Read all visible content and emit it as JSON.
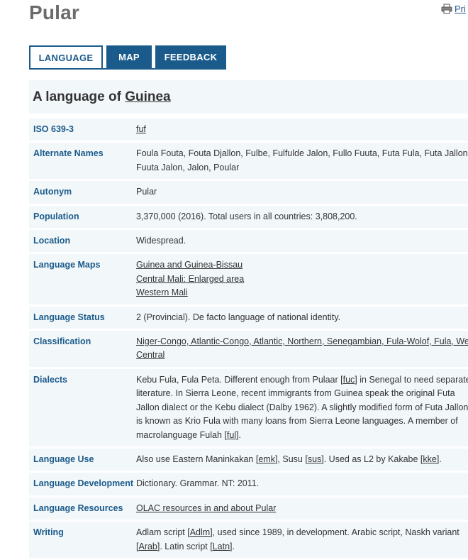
{
  "page": {
    "title": "Pular",
    "print_label": "Pri"
  },
  "tabs": [
    {
      "label": "LANGUAGE"
    },
    {
      "label": "MAP"
    },
    {
      "label": "FEEDBACK"
    }
  ],
  "heading": {
    "prefix": "A language of ",
    "country": "Guinea"
  },
  "rows": {
    "iso": {
      "label": "ISO 639-3",
      "value": "fuf"
    },
    "alternate_names": {
      "label": "Alternate Names",
      "lines": [
        "Foula Fouta, Fouta Djallon, Fulbe, Fulfulde Jalon, Fullo Fuuta, Futa Fula, Futa Jallon,",
        "Fuuta Jalon, Jalon, Poular"
      ]
    },
    "autonym": {
      "label": "Autonym",
      "value": "Pular"
    },
    "population": {
      "label": "Population",
      "value": "3,370,000 (2016). Total users in all countries: 3,808,200."
    },
    "location": {
      "label": "Location",
      "value": "Widespread."
    },
    "language_maps": {
      "label": "Language Maps",
      "links": [
        "Guinea and Guinea-Bissau",
        "Central Mali: Enlarged area",
        "Western Mali"
      ]
    },
    "language_status": {
      "label": "Language Status",
      "value": "2 (Provincial). De facto language of national identity."
    },
    "classification": {
      "label": "Classification",
      "lines": [
        "Niger-Congo, Atlantic-Congo, Atlantic, Northern, Senegambian, Fula-Wolof, Fula, West",
        "Central"
      ]
    },
    "dialects": {
      "label": "Dialects",
      "line1_a": "Kebu Fula, Fula Peta. Different enough from Pulaar [",
      "line1_code": "fuc",
      "line1_b": "] in Senegal to need separate",
      "line2": "literature. In Sierra Leone, recent immigrants from Guinea speak the original Futa",
      "line3": "Jallon dialect or the Kebu dialect (Dalby 1962). A slightly modified form of Futa Jallon",
      "line4": "is known as Krio Fula with many loans from Sierra Leone languages. A member of",
      "line5_a": "macrolanguage Fulah [",
      "line5_code": "ful",
      "line5_b": "]."
    },
    "language_use": {
      "label": "Language Use",
      "t1": "Also use Eastern Maninkakan [",
      "c1": "emk",
      "t2": "], Susu [",
      "c2": "sus",
      "t3": "]. Used as L2 by Kakabe [",
      "c3": "kke",
      "t4": "]."
    },
    "language_development": {
      "label": "Language Development",
      "value": "Dictionary. Grammar. NT: 2011."
    },
    "language_resources": {
      "label": "Language Resources",
      "value": "OLAC resources in and about Pular"
    },
    "writing": {
      "label": "Writing",
      "t1": "Adlam script [",
      "c1": "Adlm",
      "t2": "], used since 1989, in development. Arabic script, Naskh variant",
      "t3": "[",
      "c2": "Arab",
      "t4": "]. Latin script [",
      "c3": "Latn",
      "t5": "]."
    }
  }
}
